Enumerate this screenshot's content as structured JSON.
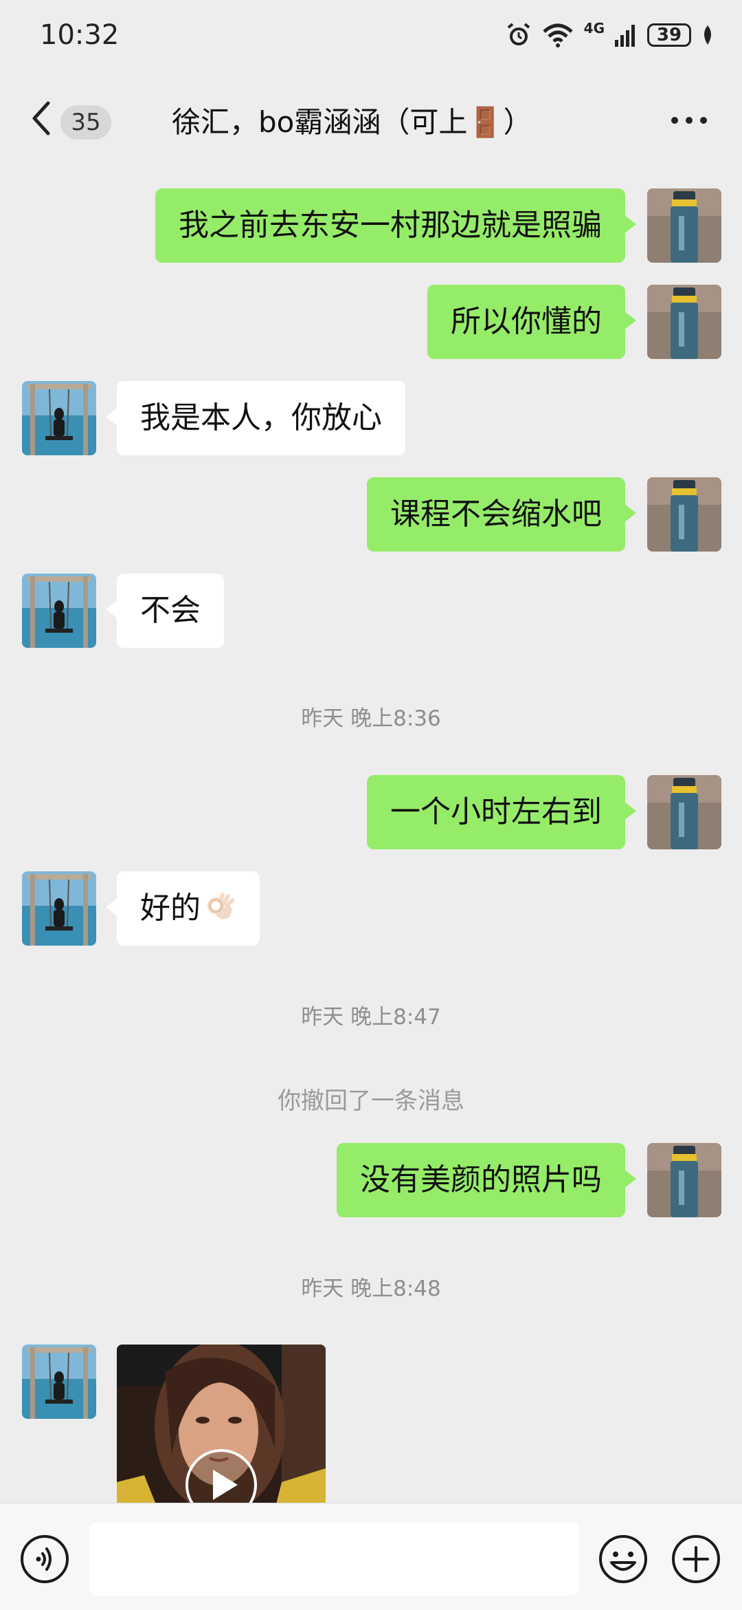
{
  "status_bar": {
    "time": "10:32",
    "network": "4G",
    "battery": "39"
  },
  "header": {
    "unread_count": "35",
    "title": "徐汇，bo霸涵涵（可上🚪）"
  },
  "messages": [
    {
      "side": "self",
      "type": "text",
      "text": "我之前去东安一村那边就是照骗"
    },
    {
      "side": "self",
      "type": "text",
      "text": "所以你懂的"
    },
    {
      "side": "other",
      "type": "text",
      "text": "我是本人，你放心"
    },
    {
      "side": "self",
      "type": "text",
      "text": "课程不会缩水吧"
    },
    {
      "side": "other",
      "type": "text",
      "text": "不会"
    },
    {
      "type": "timestamp",
      "text": "昨天 晚上8:36"
    },
    {
      "side": "self",
      "type": "text",
      "text": "一个小时左右到"
    },
    {
      "side": "other",
      "type": "text",
      "text": "好的",
      "emoji": "ok-hand"
    },
    {
      "type": "timestamp",
      "text": "昨天 晚上8:47"
    },
    {
      "type": "system",
      "text": "你撤回了一条消息"
    },
    {
      "side": "self",
      "type": "text",
      "text": "没有美颜的照片吗"
    },
    {
      "type": "timestamp",
      "text": "昨天 晚上8:48"
    },
    {
      "side": "other",
      "type": "video"
    }
  ],
  "colors": {
    "self_bubble": "#95ec69",
    "other_bubble": "#ffffff",
    "background": "#ededed"
  },
  "input": {
    "placeholder": ""
  }
}
